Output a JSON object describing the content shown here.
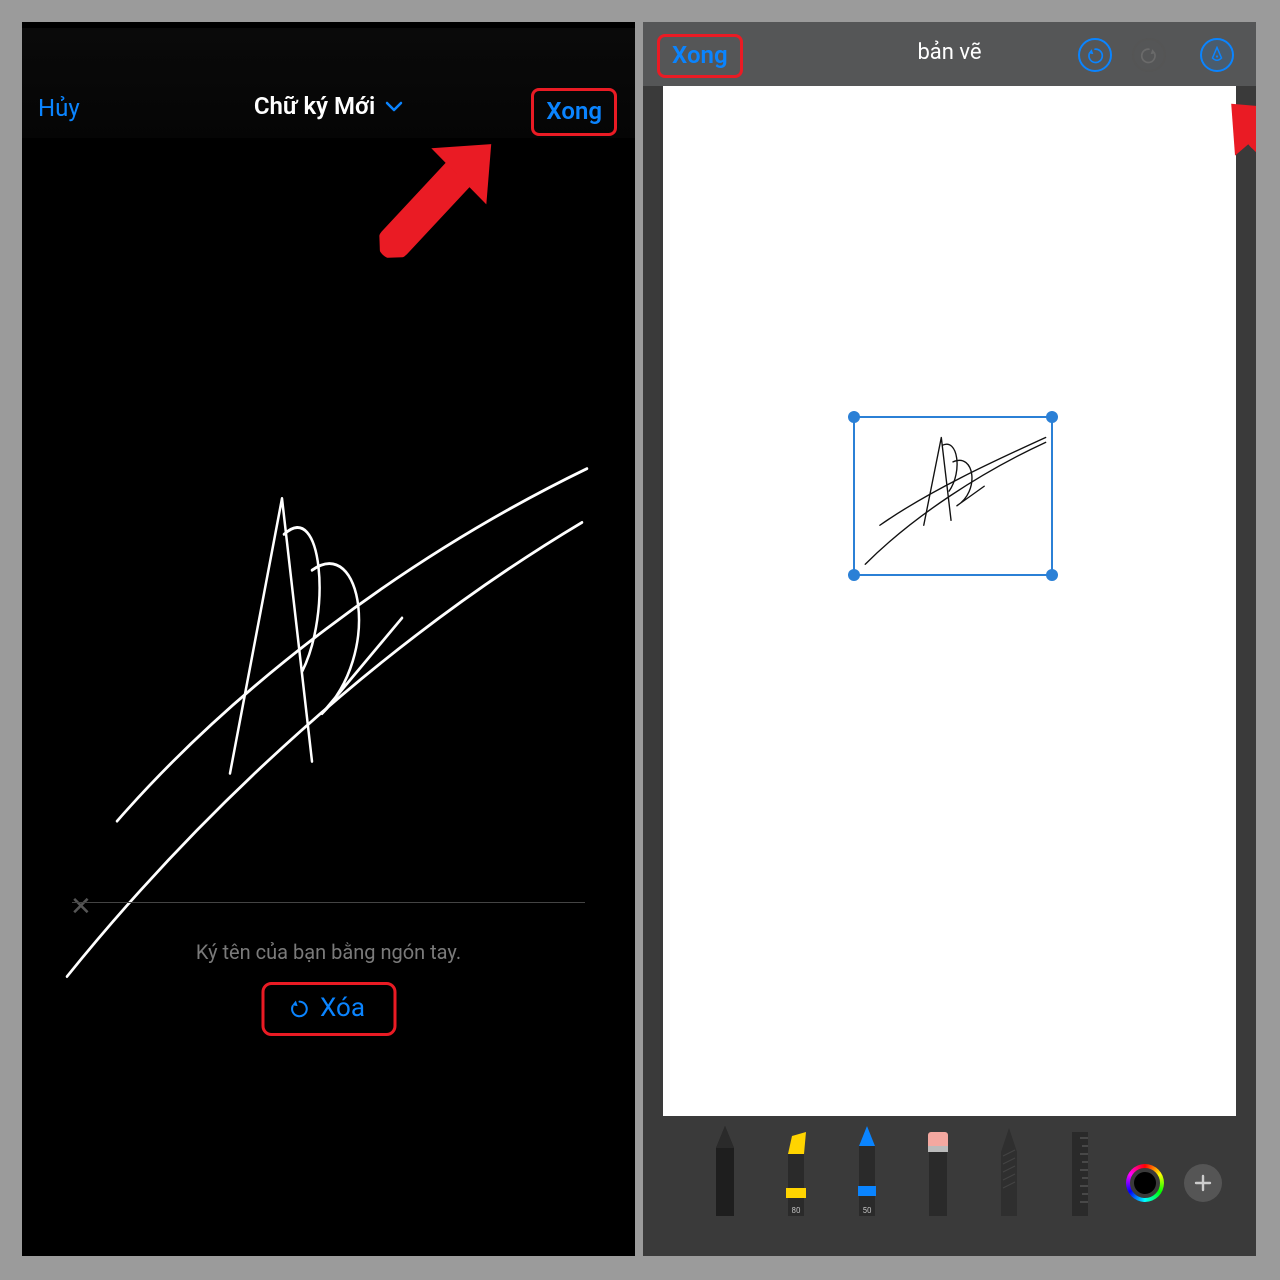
{
  "left": {
    "cancel_label": "Hủy",
    "title": "Chữ ký Mới",
    "done_label": "Xong",
    "baseline_mark": "✕",
    "hint": "Ký tên của bạn bằng ngón tay.",
    "clear_label": "Xóa"
  },
  "right": {
    "done_label": "Xong",
    "title": "bản vẽ",
    "tools": {
      "marker_opacity": "80",
      "pencil_opacity": "50"
    }
  }
}
